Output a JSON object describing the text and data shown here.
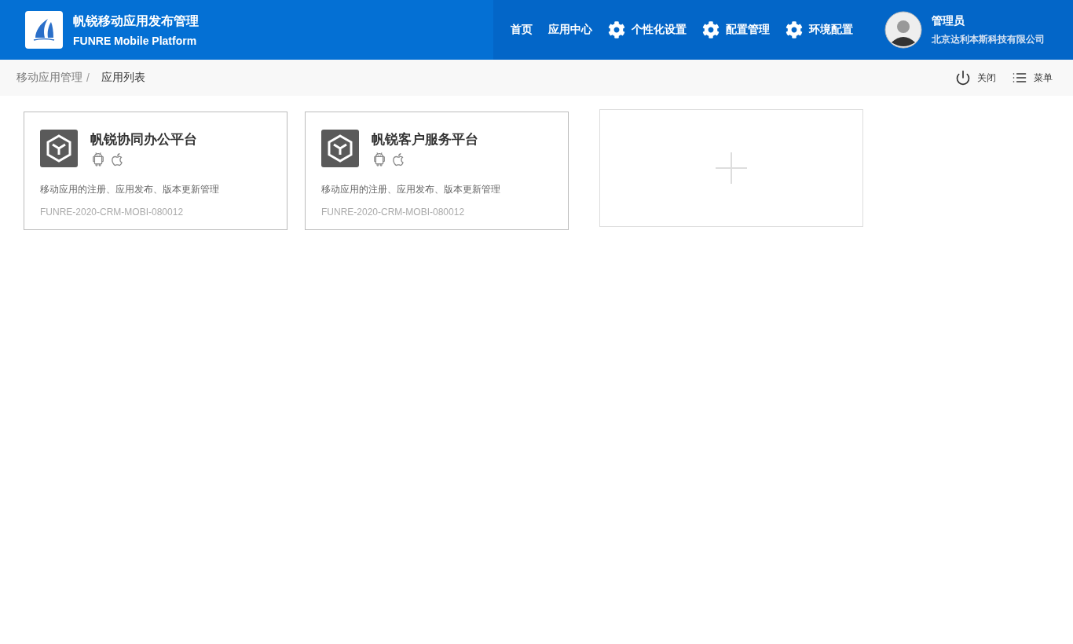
{
  "brand": {
    "title": "帆锐移动应用发布管理",
    "subtitle": "FUNRE Mobile Platform"
  },
  "nav": [
    {
      "label": "首页",
      "kind": "plain"
    },
    {
      "label": "应用中心",
      "kind": "plain"
    },
    {
      "label": "个性化设置",
      "kind": "gear"
    },
    {
      "label": "配置管理",
      "kind": "gear"
    },
    {
      "label": "环境配置",
      "kind": "gear"
    }
  ],
  "user": {
    "name": "管理员",
    "company": "北京达利本斯科技有限公司"
  },
  "breadcrumb": [
    "移动应用管理",
    "应用列表"
  ],
  "breadcrumb_separator": "/",
  "actions": [
    {
      "label": "关闭",
      "kind": "power"
    },
    {
      "label": "菜单",
      "kind": "menu"
    }
  ],
  "apps": [
    {
      "name": "帆锐协同办公平台",
      "platforms": [
        {
          "kind": "android"
        },
        {
          "kind": "ios"
        }
      ],
      "description": "移动应用的注册、应用发布、版本更新管理",
      "code": "FUNRE-2020-CRM-MOBI-080012"
    },
    {
      "name": "帆锐客户服务平台",
      "platforms": [
        {
          "kind": "android"
        },
        {
          "kind": "ios"
        }
      ],
      "description": "移动应用的注册、应用发布、版本更新管理",
      "code": "FUNRE-2020-CRM-MOBI-080012"
    }
  ]
}
